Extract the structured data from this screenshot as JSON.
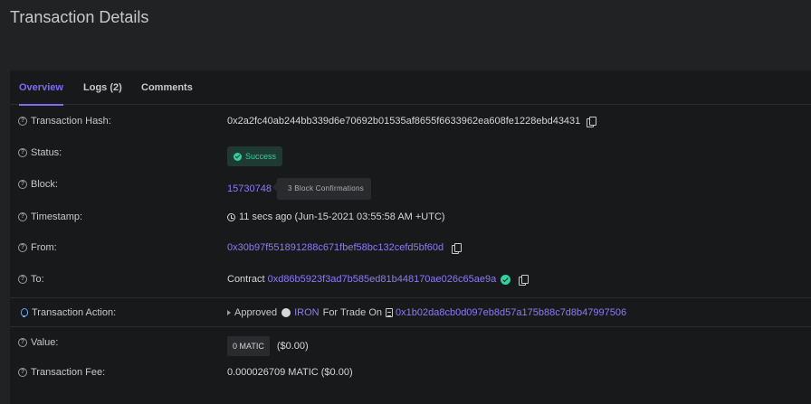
{
  "page": {
    "title": "Transaction Details"
  },
  "tabs": [
    {
      "label": "Overview",
      "active": true
    },
    {
      "label": "Logs (2)",
      "active": false
    },
    {
      "label": "Comments",
      "active": false
    }
  ],
  "icons": {
    "help": "question-circle-icon",
    "copy": "copy-icon",
    "success": "check-circle-icon",
    "clock": "clock-icon",
    "verified": "verified-check-icon",
    "action": "lightbulb-icon",
    "token": "token-icon",
    "contract_doc": "file-icon"
  },
  "colors": {
    "accent": "#7b6cf0",
    "link": "#8b7cf6",
    "success": "#2fd3a3",
    "background": "#212224",
    "card": "#18191b"
  },
  "help_glyph": "?",
  "details": {
    "hash": {
      "label": "Transaction Hash:",
      "value": "0x2a2fc40ab244bb339d6e70692b01535af8655f6633962ea608fe1228ebd43431"
    },
    "status": {
      "label": "Status:",
      "value": "Success"
    },
    "block": {
      "label": "Block:",
      "number": "15730748",
      "confirmations": "3 Block Confirmations"
    },
    "timestamp": {
      "label": "Timestamp:",
      "value": "11 secs ago (Jun-15-2021 03:55:58 AM +UTC)"
    },
    "from": {
      "label": "From:",
      "value": "0x30b97f551891288c671fbef58bc132cefd5bf60d"
    },
    "to": {
      "label": "To:",
      "prefix": "Contract",
      "value": "0xd86b5923f3ad7b585ed81b448170ae026c65ae9a"
    },
    "action": {
      "label": "Transaction Action:",
      "verb": "Approved",
      "token": "IRON",
      "middle": "For Trade On",
      "address": "0x1b02da8cb0d097eb8d57a175b88c7d8b47997506"
    },
    "value": {
      "label": "Value:",
      "amount": "0 MATIC",
      "usd": "($0.00)"
    },
    "fee": {
      "label": "Transaction Fee:",
      "value": "0.000026709 MATIC ($0.00)"
    }
  }
}
